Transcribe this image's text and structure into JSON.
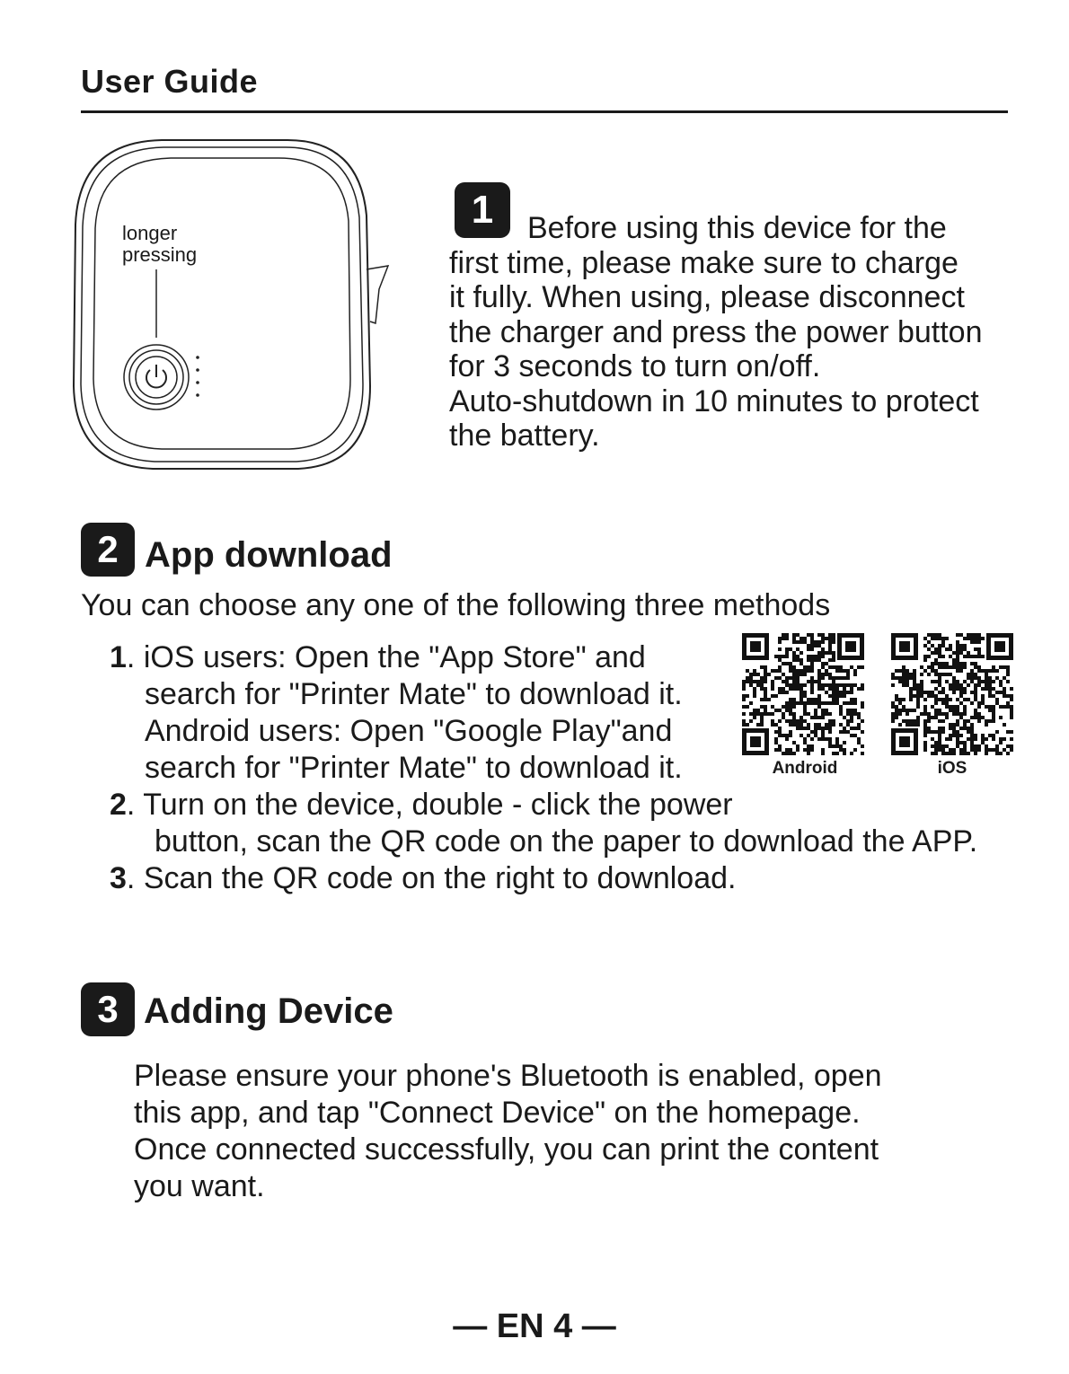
{
  "header": {
    "title": "User Guide"
  },
  "device": {
    "label_line1": "longer",
    "label_line2": "pressing"
  },
  "section1": {
    "number": "1",
    "lines": [
      "Before using this device for the",
      "first time, please make sure to charge",
      "it fully. When using, please disconnect",
      "the charger and press the power button",
      "for 3 seconds to turn on/off.",
      "Auto-shutdown in 10 minutes to protect",
      "the battery."
    ]
  },
  "section2": {
    "number": "2",
    "title": "App download",
    "intro": "You can choose any one of the following three methods",
    "item1_num": "1",
    "item1_lines": [
      ". iOS users: Open the \"App Store\" and",
      "search for \"Printer Mate\" to download it.",
      "Android users: Open \"Google Play\"and",
      "search for \"Printer Mate\" to download it."
    ],
    "item2_num": "2",
    "item2_lines": [
      ". Turn on the device, double - click the power",
      "button, scan the QR code on the paper to download the APP."
    ],
    "item3_num": "3",
    "item3_line": ". Scan the QR code on the right to download.",
    "qr_android_caption": "Android",
    "qr_ios_caption": "iOS"
  },
  "section3": {
    "number": "3",
    "title": "Adding Device",
    "lines": [
      "Please ensure your phone's Bluetooth is enabled, open",
      "this app, and tap \"Connect Device\" on the homepage.",
      "Once connected successfully, you can print the content",
      "you want."
    ]
  },
  "footer": {
    "page_label": "— EN 4 —"
  }
}
